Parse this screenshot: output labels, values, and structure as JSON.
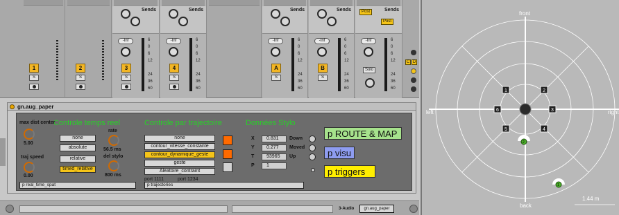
{
  "mixer": {
    "sends_label": "Sends",
    "send_a": "A",
    "send_b": "B",
    "inf": "-Inf",
    "scale": [
      "6",
      "0",
      "6",
      "12",
      "24",
      "36",
      "60"
    ],
    "tracks": [
      {
        "num": "1",
        "solo": "S"
      },
      {
        "num": "2",
        "solo": "S"
      },
      {
        "num": "3",
        "solo": "S"
      },
      {
        "num": "4",
        "solo": "S"
      },
      {
        "num": "A",
        "solo": "S"
      },
      {
        "num": "B",
        "solo": "S"
      }
    ],
    "master": {
      "post1": "Post",
      "post2": "Post",
      "solo": "Solo",
      "small_c": "C",
      "small_d": "D"
    }
  },
  "device": {
    "title": "gn.aug_paper",
    "temps_reel_title": "Controle temps reel",
    "trajectoire_title": "Controle par trajectoire",
    "stylo_title": "Données Stylo",
    "max_dist_label": "max dist center",
    "max_dist_value": "5.00",
    "traj_speed_label": "traj speed",
    "traj_speed_value": "0.00",
    "rate_label": "rate",
    "rate_value": "56.5 ms",
    "del_stylo_label": "del stylo",
    "del_stylo_value": "800 ms",
    "mode_buttons": [
      "none",
      "absolute",
      "relative",
      "timed_relative"
    ],
    "traj_buttons": [
      "none",
      "contour_vitesse_constante",
      "contour_dynamique_geste",
      "geste",
      "Aleatoire_contraint"
    ],
    "ports": [
      "port 1111",
      "port 1234"
    ],
    "xyt_labels": [
      "X",
      "Y",
      "T",
      "P"
    ],
    "xyt_values": [
      "0.831",
      "0.277",
      "93965",
      "1"
    ],
    "state_labels": [
      "Down",
      "Moved",
      "Up"
    ],
    "route_map": "p ROUTE & MAP",
    "visu": "p visu",
    "triggers": "p triggers",
    "real_time_spat": "p real_time_spat",
    "trajectories": "p trajectories"
  },
  "bottom": {
    "audio_label": "3-Audio",
    "device_tab": "gn.aug_paper"
  },
  "space": {
    "front": "front",
    "back": "back",
    "left": "left",
    "right": "right",
    "scale": "1.44 m",
    "speakers": [
      "1",
      "2",
      "3",
      "4",
      "5",
      "6",
      "7",
      "8"
    ],
    "sources": [
      "1",
      "2"
    ]
  },
  "colors": {
    "accent_yellow": "#f5c418",
    "green_title": "#26d426",
    "orange": "#ff6a00",
    "source_green": "#4caf2a"
  }
}
